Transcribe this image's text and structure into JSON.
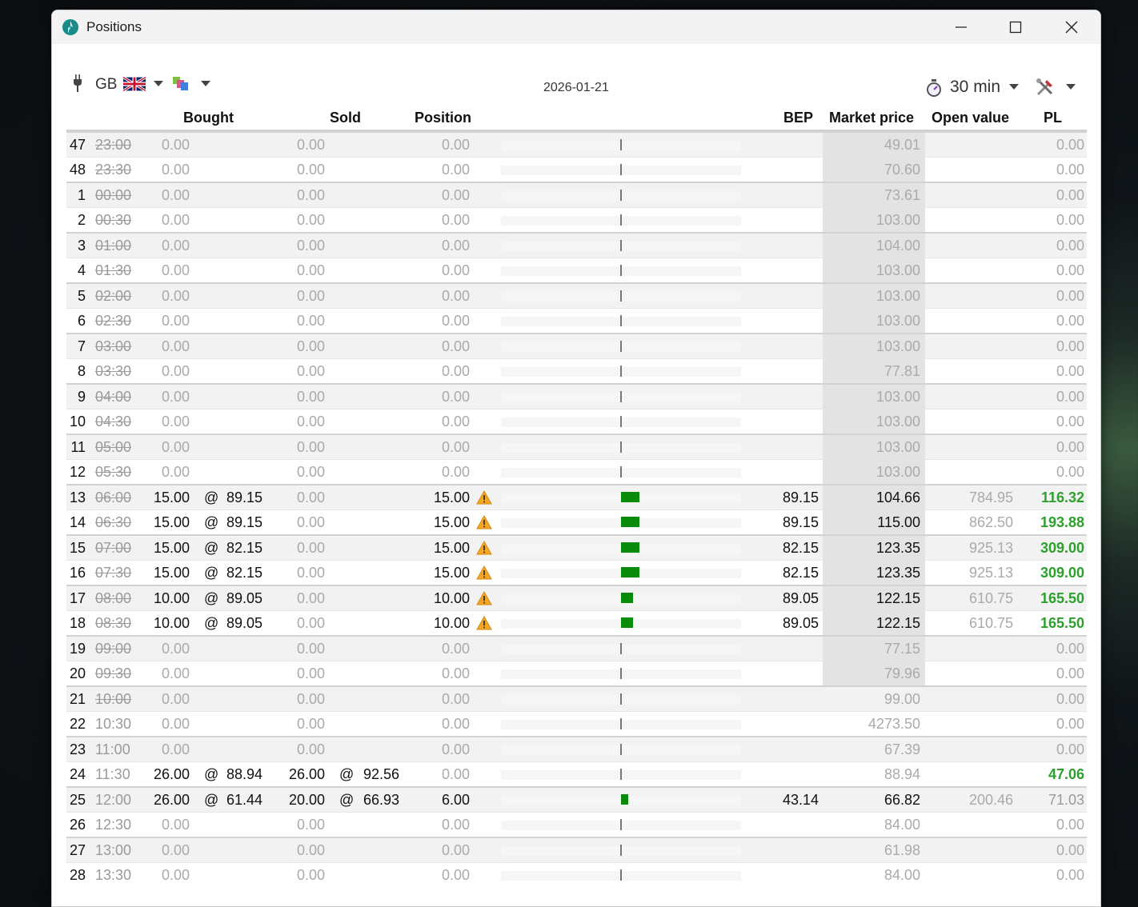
{
  "window": {
    "title": "Positions"
  },
  "toolbar": {
    "region": "GB",
    "date": "2026-01-21",
    "interval": "30 min"
  },
  "headers": {
    "bought": "Bought",
    "sold": "Sold",
    "position": "Position",
    "bep": "BEP",
    "market_price": "Market price",
    "open_value": "Open value",
    "pl": "PL"
  },
  "colors": {
    "profit": "#2ea02e",
    "position_bar": "#0a8a0a",
    "warning": "#f5a623"
  },
  "rows": [
    {
      "num": "47",
      "time": "23:00",
      "past": true,
      "bought_qty": "0.00",
      "bought_at": "",
      "bought_price": "",
      "sold_qty": "0.00",
      "sold_at": "",
      "sold_price": "",
      "position": "0.00",
      "position_value": 0,
      "warning": false,
      "bep": "",
      "market_price": "49.01",
      "open_value": "",
      "pl": "0.00",
      "pl_style": "dim",
      "active": false
    },
    {
      "num": "48",
      "time": "23:30",
      "past": true,
      "bought_qty": "0.00",
      "bought_at": "",
      "bought_price": "",
      "sold_qty": "0.00",
      "sold_at": "",
      "sold_price": "",
      "position": "0.00",
      "position_value": 0,
      "warning": false,
      "bep": "",
      "market_price": "70.60",
      "open_value": "",
      "pl": "0.00",
      "pl_style": "dim",
      "active": false
    },
    {
      "num": "1",
      "time": "00:00",
      "past": true,
      "bought_qty": "0.00",
      "bought_at": "",
      "bought_price": "",
      "sold_qty": "0.00",
      "sold_at": "",
      "sold_price": "",
      "position": "0.00",
      "position_value": 0,
      "warning": false,
      "bep": "",
      "market_price": "73.61",
      "open_value": "",
      "pl": "0.00",
      "pl_style": "dim",
      "active": false
    },
    {
      "num": "2",
      "time": "00:30",
      "past": true,
      "bought_qty": "0.00",
      "bought_at": "",
      "bought_price": "",
      "sold_qty": "0.00",
      "sold_at": "",
      "sold_price": "",
      "position": "0.00",
      "position_value": 0,
      "warning": false,
      "bep": "",
      "market_price": "103.00",
      "open_value": "",
      "pl": "0.00",
      "pl_style": "dim",
      "active": false
    },
    {
      "num": "3",
      "time": "01:00",
      "past": true,
      "bought_qty": "0.00",
      "bought_at": "",
      "bought_price": "",
      "sold_qty": "0.00",
      "sold_at": "",
      "sold_price": "",
      "position": "0.00",
      "position_value": 0,
      "warning": false,
      "bep": "",
      "market_price": "104.00",
      "open_value": "",
      "pl": "0.00",
      "pl_style": "dim",
      "active": false
    },
    {
      "num": "4",
      "time": "01:30",
      "past": true,
      "bought_qty": "0.00",
      "bought_at": "",
      "bought_price": "",
      "sold_qty": "0.00",
      "sold_at": "",
      "sold_price": "",
      "position": "0.00",
      "position_value": 0,
      "warning": false,
      "bep": "",
      "market_price": "103.00",
      "open_value": "",
      "pl": "0.00",
      "pl_style": "dim",
      "active": false
    },
    {
      "num": "5",
      "time": "02:00",
      "past": true,
      "bought_qty": "0.00",
      "bought_at": "",
      "bought_price": "",
      "sold_qty": "0.00",
      "sold_at": "",
      "sold_price": "",
      "position": "0.00",
      "position_value": 0,
      "warning": false,
      "bep": "",
      "market_price": "103.00",
      "open_value": "",
      "pl": "0.00",
      "pl_style": "dim",
      "active": false
    },
    {
      "num": "6",
      "time": "02:30",
      "past": true,
      "bought_qty": "0.00",
      "bought_at": "",
      "bought_price": "",
      "sold_qty": "0.00",
      "sold_at": "",
      "sold_price": "",
      "position": "0.00",
      "position_value": 0,
      "warning": false,
      "bep": "",
      "market_price": "103.00",
      "open_value": "",
      "pl": "0.00",
      "pl_style": "dim",
      "active": false
    },
    {
      "num": "7",
      "time": "03:00",
      "past": true,
      "bought_qty": "0.00",
      "bought_at": "",
      "bought_price": "",
      "sold_qty": "0.00",
      "sold_at": "",
      "sold_price": "",
      "position": "0.00",
      "position_value": 0,
      "warning": false,
      "bep": "",
      "market_price": "103.00",
      "open_value": "",
      "pl": "0.00",
      "pl_style": "dim",
      "active": false
    },
    {
      "num": "8",
      "time": "03:30",
      "past": true,
      "bought_qty": "0.00",
      "bought_at": "",
      "bought_price": "",
      "sold_qty": "0.00",
      "sold_at": "",
      "sold_price": "",
      "position": "0.00",
      "position_value": 0,
      "warning": false,
      "bep": "",
      "market_price": "77.81",
      "open_value": "",
      "pl": "0.00",
      "pl_style": "dim",
      "active": false
    },
    {
      "num": "9",
      "time": "04:00",
      "past": true,
      "bought_qty": "0.00",
      "bought_at": "",
      "bought_price": "",
      "sold_qty": "0.00",
      "sold_at": "",
      "sold_price": "",
      "position": "0.00",
      "position_value": 0,
      "warning": false,
      "bep": "",
      "market_price": "103.00",
      "open_value": "",
      "pl": "0.00",
      "pl_style": "dim",
      "active": false
    },
    {
      "num": "10",
      "time": "04:30",
      "past": true,
      "bought_qty": "0.00",
      "bought_at": "",
      "bought_price": "",
      "sold_qty": "0.00",
      "sold_at": "",
      "sold_price": "",
      "position": "0.00",
      "position_value": 0,
      "warning": false,
      "bep": "",
      "market_price": "103.00",
      "open_value": "",
      "pl": "0.00",
      "pl_style": "dim",
      "active": false
    },
    {
      "num": "11",
      "time": "05:00",
      "past": true,
      "bought_qty": "0.00",
      "bought_at": "",
      "bought_price": "",
      "sold_qty": "0.00",
      "sold_at": "",
      "sold_price": "",
      "position": "0.00",
      "position_value": 0,
      "warning": false,
      "bep": "",
      "market_price": "103.00",
      "open_value": "",
      "pl": "0.00",
      "pl_style": "dim",
      "active": false
    },
    {
      "num": "12",
      "time": "05:30",
      "past": true,
      "bought_qty": "0.00",
      "bought_at": "",
      "bought_price": "",
      "sold_qty": "0.00",
      "sold_at": "",
      "sold_price": "",
      "position": "0.00",
      "position_value": 0,
      "warning": false,
      "bep": "",
      "market_price": "103.00",
      "open_value": "",
      "pl": "0.00",
      "pl_style": "dim",
      "active": false
    },
    {
      "num": "13",
      "time": "06:00",
      "past": true,
      "bought_qty": "15.00",
      "bought_at": "@",
      "bought_price": "89.15",
      "sold_qty": "0.00",
      "sold_at": "",
      "sold_price": "",
      "position": "15.00",
      "position_value": 15,
      "warning": true,
      "bep": "89.15",
      "market_price": "104.66",
      "open_value": "784.95",
      "pl": "116.32",
      "pl_style": "green",
      "active": true
    },
    {
      "num": "14",
      "time": "06:30",
      "past": true,
      "bought_qty": "15.00",
      "bought_at": "@",
      "bought_price": "89.15",
      "sold_qty": "0.00",
      "sold_at": "",
      "sold_price": "",
      "position": "15.00",
      "position_value": 15,
      "warning": true,
      "bep": "89.15",
      "market_price": "115.00",
      "open_value": "862.50",
      "pl": "193.88",
      "pl_style": "green",
      "active": true
    },
    {
      "num": "15",
      "time": "07:00",
      "past": true,
      "bought_qty": "15.00",
      "bought_at": "@",
      "bought_price": "82.15",
      "sold_qty": "0.00",
      "sold_at": "",
      "sold_price": "",
      "position": "15.00",
      "position_value": 15,
      "warning": true,
      "bep": "82.15",
      "market_price": "123.35",
      "open_value": "925.13",
      "pl": "309.00",
      "pl_style": "green",
      "active": true
    },
    {
      "num": "16",
      "time": "07:30",
      "past": true,
      "bought_qty": "15.00",
      "bought_at": "@",
      "bought_price": "82.15",
      "sold_qty": "0.00",
      "sold_at": "",
      "sold_price": "",
      "position": "15.00",
      "position_value": 15,
      "warning": true,
      "bep": "82.15",
      "market_price": "123.35",
      "open_value": "925.13",
      "pl": "309.00",
      "pl_style": "green",
      "active": true
    },
    {
      "num": "17",
      "time": "08:00",
      "past": true,
      "bought_qty": "10.00",
      "bought_at": "@",
      "bought_price": "89.05",
      "sold_qty": "0.00",
      "sold_at": "",
      "sold_price": "",
      "position": "10.00",
      "position_value": 10,
      "warning": true,
      "bep": "89.05",
      "market_price": "122.15",
      "open_value": "610.75",
      "pl": "165.50",
      "pl_style": "green",
      "active": true
    },
    {
      "num": "18",
      "time": "08:30",
      "past": true,
      "bought_qty": "10.00",
      "bought_at": "@",
      "bought_price": "89.05",
      "sold_qty": "0.00",
      "sold_at": "",
      "sold_price": "",
      "position": "10.00",
      "position_value": 10,
      "warning": true,
      "bep": "89.05",
      "market_price": "122.15",
      "open_value": "610.75",
      "pl": "165.50",
      "pl_style": "green",
      "active": true
    },
    {
      "num": "19",
      "time": "09:00",
      "past": true,
      "bought_qty": "0.00",
      "bought_at": "",
      "bought_price": "",
      "sold_qty": "0.00",
      "sold_at": "",
      "sold_price": "",
      "position": "0.00",
      "position_value": 0,
      "warning": false,
      "bep": "",
      "market_price": "77.15",
      "open_value": "",
      "pl": "0.00",
      "pl_style": "dim",
      "active": false
    },
    {
      "num": "20",
      "time": "09:30",
      "past": true,
      "bought_qty": "0.00",
      "bought_at": "",
      "bought_price": "",
      "sold_qty": "0.00",
      "sold_at": "",
      "sold_price": "",
      "position": "0.00",
      "position_value": 0,
      "warning": false,
      "bep": "",
      "market_price": "79.96",
      "open_value": "",
      "pl": "0.00",
      "pl_style": "dim",
      "active": false
    },
    {
      "num": "21",
      "time": "10:00",
      "past": true,
      "bought_qty": "0.00",
      "bought_at": "",
      "bought_price": "",
      "sold_qty": "0.00",
      "sold_at": "",
      "sold_price": "",
      "position": "0.00",
      "position_value": 0,
      "warning": false,
      "bep": "",
      "market_price": "99.00",
      "open_value": "",
      "pl": "0.00",
      "pl_style": "dim",
      "active": false
    },
    {
      "num": "22",
      "time": "10:30",
      "past": false,
      "bought_qty": "0.00",
      "bought_at": "",
      "bought_price": "",
      "sold_qty": "0.00",
      "sold_at": "",
      "sold_price": "",
      "position": "0.00",
      "position_value": 0,
      "warning": false,
      "bep": "",
      "market_price": "4273.50",
      "open_value": "",
      "pl": "0.00",
      "pl_style": "dim",
      "active": false
    },
    {
      "num": "23",
      "time": "11:00",
      "past": false,
      "bought_qty": "0.00",
      "bought_at": "",
      "bought_price": "",
      "sold_qty": "0.00",
      "sold_at": "",
      "sold_price": "",
      "position": "0.00",
      "position_value": 0,
      "warning": false,
      "bep": "",
      "market_price": "67.39",
      "open_value": "",
      "pl": "0.00",
      "pl_style": "dim",
      "active": false
    },
    {
      "num": "24",
      "time": "11:30",
      "past": false,
      "bought_qty": "26.00",
      "bought_at": "@",
      "bought_price": "88.94",
      "sold_qty": "26.00",
      "sold_at": "@",
      "sold_price": "92.56",
      "position": "0.00",
      "position_value": 0,
      "warning": false,
      "bep": "",
      "market_price": "88.94",
      "open_value": "",
      "pl": "47.06",
      "pl_style": "green",
      "active": false
    },
    {
      "num": "25",
      "time": "12:00",
      "past": false,
      "bought_qty": "26.00",
      "bought_at": "@",
      "bought_price": "61.44",
      "sold_qty": "20.00",
      "sold_at": "@",
      "sold_price": "66.93",
      "position": "6.00",
      "position_value": 6,
      "warning": false,
      "bep": "43.14",
      "market_price": "66.82",
      "open_value": "200.46",
      "pl": "71.03",
      "pl_style": "lightgreen",
      "active": true
    },
    {
      "num": "26",
      "time": "12:30",
      "past": false,
      "bought_qty": "0.00",
      "bought_at": "",
      "bought_price": "",
      "sold_qty": "0.00",
      "sold_at": "",
      "sold_price": "",
      "position": "0.00",
      "position_value": 0,
      "warning": false,
      "bep": "",
      "market_price": "84.00",
      "open_value": "",
      "pl": "0.00",
      "pl_style": "dim",
      "active": false
    },
    {
      "num": "27",
      "time": "13:00",
      "past": false,
      "bought_qty": "0.00",
      "bought_at": "",
      "bought_price": "",
      "sold_qty": "0.00",
      "sold_at": "",
      "sold_price": "",
      "position": "0.00",
      "position_value": 0,
      "warning": false,
      "bep": "",
      "market_price": "61.98",
      "open_value": "",
      "pl": "0.00",
      "pl_style": "dim",
      "active": false
    },
    {
      "num": "28",
      "time": "13:30",
      "past": false,
      "bought_qty": "0.00",
      "bought_at": "",
      "bought_price": "",
      "sold_qty": "0.00",
      "sold_at": "",
      "sold_price": "",
      "position": "0.00",
      "position_value": 0,
      "warning": false,
      "bep": "",
      "market_price": "84.00",
      "open_value": "",
      "pl": "0.00",
      "pl_style": "dim",
      "active": false
    }
  ]
}
